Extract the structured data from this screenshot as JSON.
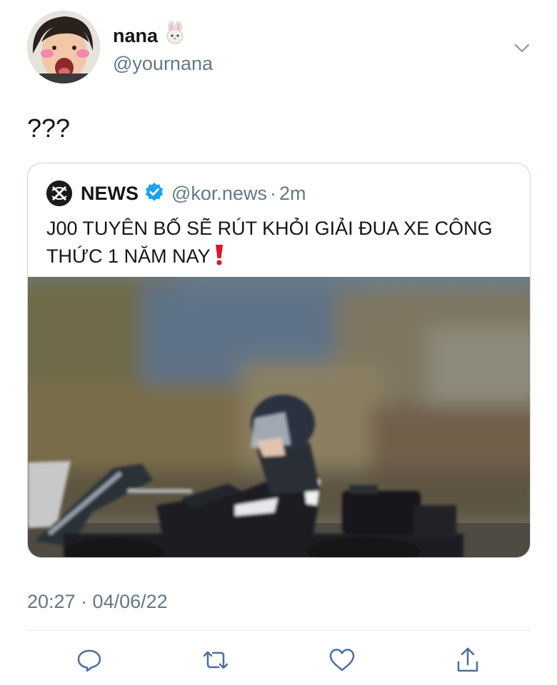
{
  "author": {
    "display_name": "nana",
    "name_emoji": "rabbit-face-emoji",
    "handle": "@yournana"
  },
  "tweet": {
    "text": "???",
    "timestamp": "20:27 · 04/06/22"
  },
  "quoted_tweet": {
    "display_name": "NEWS",
    "verified": true,
    "handle": "@kor.news",
    "separator": "·",
    "time": "2m",
    "text": "J00 TUYÊN BỐ SẼ RÚT KHỎI GIẢI ĐUA XE CÔNG THỨC 1 NĂM NAY",
    "text_emoji": "red-exclamation-mark-emoji",
    "media_description_icon": "photo"
  },
  "actions": [
    "reply-icon",
    "retweet-icon",
    "like-icon",
    "share-icon"
  ],
  "colors": {
    "text_primary": "#14171a",
    "text_secondary": "#657786",
    "verified_blue": "#1da1f2",
    "border": "#ccd6dd",
    "action_icon": "#4a6fa0"
  }
}
